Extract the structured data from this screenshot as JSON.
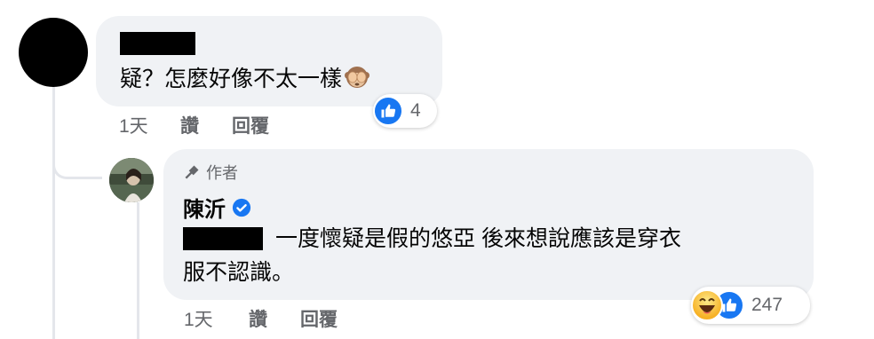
{
  "comment1": {
    "text": "疑？怎麼好像不太一樣",
    "emoji": "see-no-evil-monkey",
    "time": "1天",
    "like_label": "讚",
    "reply_label": "回覆",
    "reaction_count": "4",
    "reaction_types": [
      "like"
    ]
  },
  "reply": {
    "badge_label": "作者",
    "author_name": "陳沂",
    "verified": true,
    "text_line1": "一度懷疑是假的悠亞 後來想說應該是穿衣",
    "text_line2": "服不認識。",
    "time": "1天",
    "like_label": "讚",
    "reply_label": "回覆",
    "reaction_count": "247",
    "reaction_types": [
      "haha",
      "like"
    ]
  },
  "colors": {
    "bubble": "#f0f2f5",
    "meta": "#65676b",
    "like_blue": "#1877f2",
    "thread_line": "#e4e6eb"
  }
}
